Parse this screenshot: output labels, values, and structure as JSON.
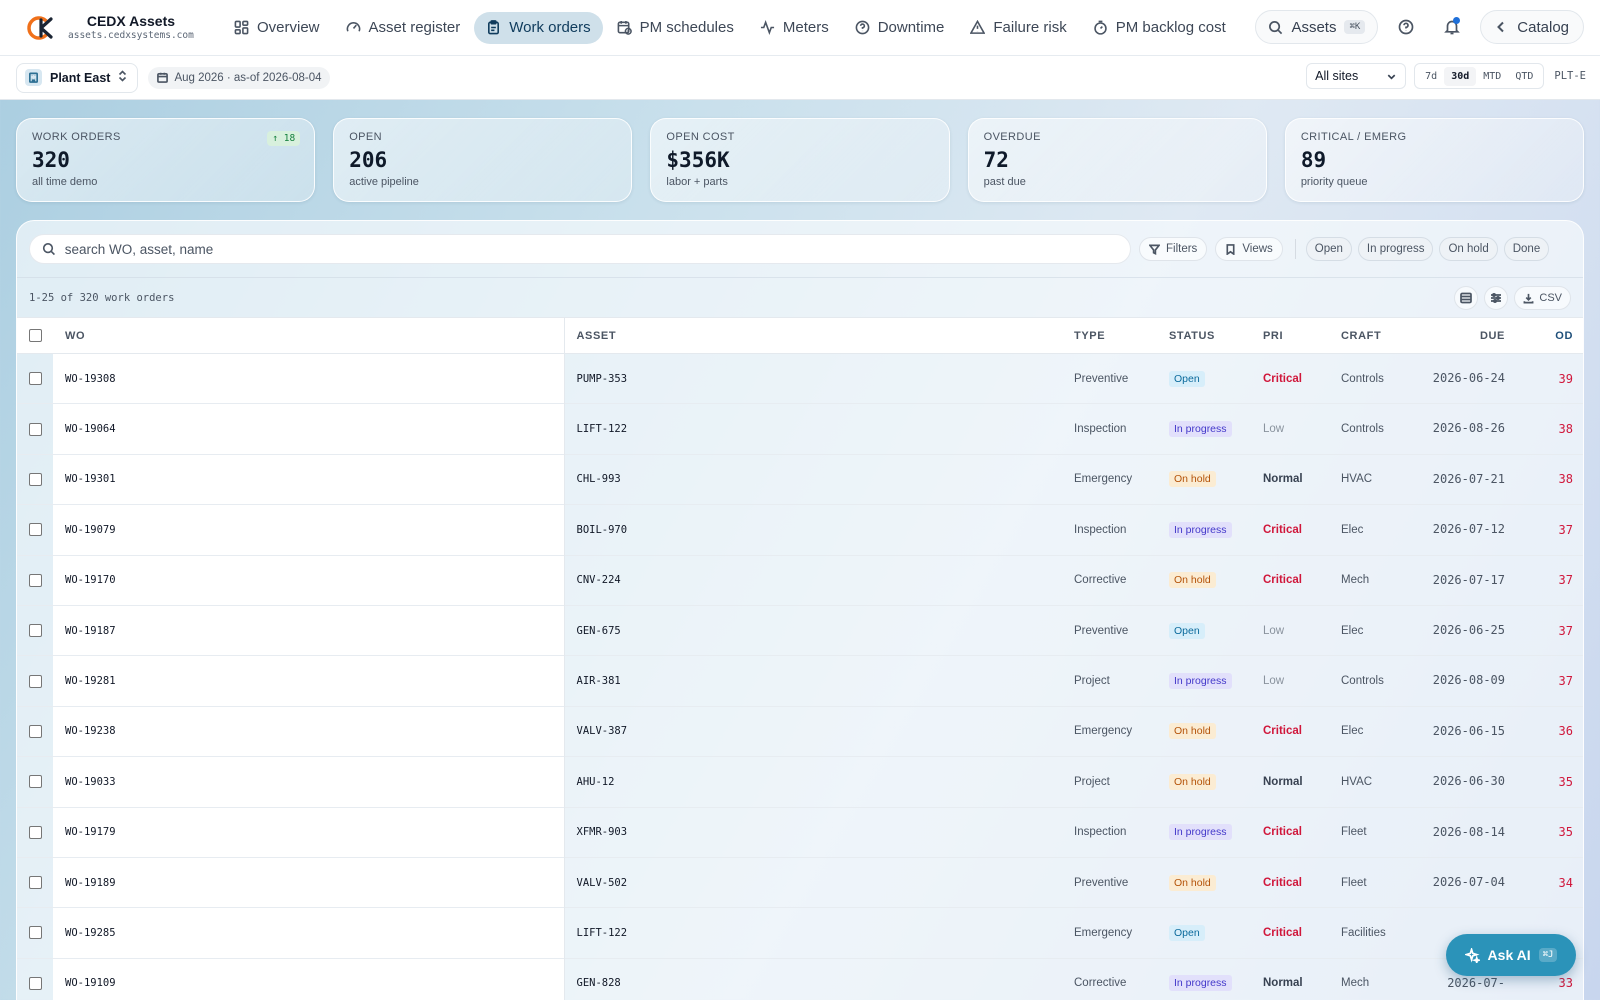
{
  "app": {
    "name": "CEDX Assets",
    "domain": "assets.cedxsystems.com",
    "accent": "#2b93b9"
  },
  "nav": {
    "items": [
      {
        "label": "Overview",
        "icon": "grid-icon"
      },
      {
        "label": "Asset register",
        "icon": "gauge-icon"
      },
      {
        "label": "Work orders",
        "icon": "clipboard-icon",
        "active": true
      },
      {
        "label": "PM schedules",
        "icon": "calendar-clock-icon"
      },
      {
        "label": "Meters",
        "icon": "activity-icon"
      },
      {
        "label": "Downtime",
        "icon": "question-circle-icon"
      },
      {
        "label": "Failure risk",
        "icon": "warning-triangle-icon"
      },
      {
        "label": "PM backlog cost",
        "icon": "timer-icon"
      }
    ],
    "assets_label": "Assets",
    "assets_kbd": "⌘K",
    "catalog_label": "Catalog"
  },
  "subbar": {
    "plant": "Plant East",
    "period": "Aug 2026 · as-of 2026-08-04",
    "site_select": "All sites",
    "ranges": [
      "7d",
      "30d",
      "MTD",
      "QTD"
    ],
    "active_range": "30d",
    "plant_code": "PLT-E"
  },
  "kpis": [
    {
      "label": "Work orders",
      "value": "320",
      "sub": "all time demo",
      "badge": "↑ 18"
    },
    {
      "label": "Open",
      "value": "206",
      "sub": "active pipeline"
    },
    {
      "label": "Open cost",
      "value": "$356K",
      "sub": "labor + parts"
    },
    {
      "label": "Overdue",
      "value": "72",
      "sub": "past due"
    },
    {
      "label": "Critical / Emerg",
      "value": "89",
      "sub": "priority queue"
    }
  ],
  "toolbar": {
    "search_placeholder": "search WO, asset, name",
    "filters_label": "Filters",
    "views_label": "Views",
    "chips": [
      "Open",
      "In progress",
      "On hold",
      "Done"
    ],
    "count_text": "1-25 of 320 work orders",
    "csv_label": "CSV"
  },
  "table": {
    "columns": {
      "wo": "WO",
      "asset": "ASSET",
      "type": "TYPE",
      "status": "STATUS",
      "pri": "PRI",
      "craft": "CRAFT",
      "due": "DUE",
      "od": "OD"
    },
    "rows": [
      {
        "wo": "WO-19308",
        "asset": "PUMP-353",
        "type": "Preventive",
        "status": "Open",
        "pri": "Critical",
        "craft": "Controls",
        "due": "2026-06-24",
        "od": "39"
      },
      {
        "wo": "WO-19064",
        "asset": "LIFT-122",
        "type": "Inspection",
        "status": "In progress",
        "pri": "Low",
        "craft": "Controls",
        "due": "2026-08-26",
        "od": "38"
      },
      {
        "wo": "WO-19301",
        "asset": "CHL-993",
        "type": "Emergency",
        "status": "On hold",
        "pri": "Normal",
        "craft": "HVAC",
        "due": "2026-07-21",
        "od": "38"
      },
      {
        "wo": "WO-19079",
        "asset": "BOIL-970",
        "type": "Inspection",
        "status": "In progress",
        "pri": "Critical",
        "craft": "Elec",
        "due": "2026-07-12",
        "od": "37"
      },
      {
        "wo": "WO-19170",
        "asset": "CNV-224",
        "type": "Corrective",
        "status": "On hold",
        "pri": "Critical",
        "craft": "Mech",
        "due": "2026-07-17",
        "od": "37"
      },
      {
        "wo": "WO-19187",
        "asset": "GEN-675",
        "type": "Preventive",
        "status": "Open",
        "pri": "Low",
        "craft": "Elec",
        "due": "2026-06-25",
        "od": "37"
      },
      {
        "wo": "WO-19281",
        "asset": "AIR-381",
        "type": "Project",
        "status": "In progress",
        "pri": "Low",
        "craft": "Controls",
        "due": "2026-08-09",
        "od": "37"
      },
      {
        "wo": "WO-19238",
        "asset": "VALV-387",
        "type": "Emergency",
        "status": "On hold",
        "pri": "Critical",
        "craft": "Elec",
        "due": "2026-06-15",
        "od": "36"
      },
      {
        "wo": "WO-19033",
        "asset": "AHU-12",
        "type": "Project",
        "status": "On hold",
        "pri": "Normal",
        "craft": "HVAC",
        "due": "2026-06-30",
        "od": "35"
      },
      {
        "wo": "WO-19179",
        "asset": "XFMR-903",
        "type": "Inspection",
        "status": "In progress",
        "pri": "Critical",
        "craft": "Fleet",
        "due": "2026-08-14",
        "od": "35"
      },
      {
        "wo": "WO-19189",
        "asset": "VALV-502",
        "type": "Preventive",
        "status": "On hold",
        "pri": "Critical",
        "craft": "Fleet",
        "due": "2026-07-04",
        "od": "34"
      },
      {
        "wo": "WO-19285",
        "asset": "LIFT-122",
        "type": "Emergency",
        "status": "Open",
        "pri": "Critical",
        "craft": "Facilities",
        "due": "",
        "od": ""
      },
      {
        "wo": "WO-19109",
        "asset": "GEN-828",
        "type": "Corrective",
        "status": "In progress",
        "pri": "Normal",
        "craft": "Mech",
        "due": "2026-07-",
        "od": "33"
      }
    ]
  },
  "ask_ai": {
    "label": "Ask AI",
    "kbd": "⌘J"
  }
}
